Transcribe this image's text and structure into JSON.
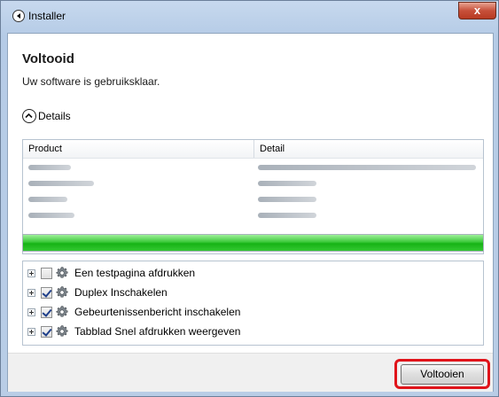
{
  "window": {
    "title": "Installer",
    "close_label": "x"
  },
  "main": {
    "heading": "Voltooid",
    "subheading": "Uw software is gebruiksklaar.",
    "details_label": "Details"
  },
  "table": {
    "columns": [
      "Product",
      "Detail"
    ]
  },
  "progress": {
    "fraction": 1.0
  },
  "options": [
    {
      "label": "Een testpagina afdrukken",
      "checked": false
    },
    {
      "label": "Duplex Inschakelen",
      "checked": true
    },
    {
      "label": "Gebeurtenissenbericht inschakelen",
      "checked": true
    },
    {
      "label": "Tabblad Snel afdrukken weergeven",
      "checked": true
    }
  ],
  "footer": {
    "finish_label": "Voltooien"
  },
  "colors": {
    "highlight": "#e0141a",
    "progress": "#16b315"
  }
}
